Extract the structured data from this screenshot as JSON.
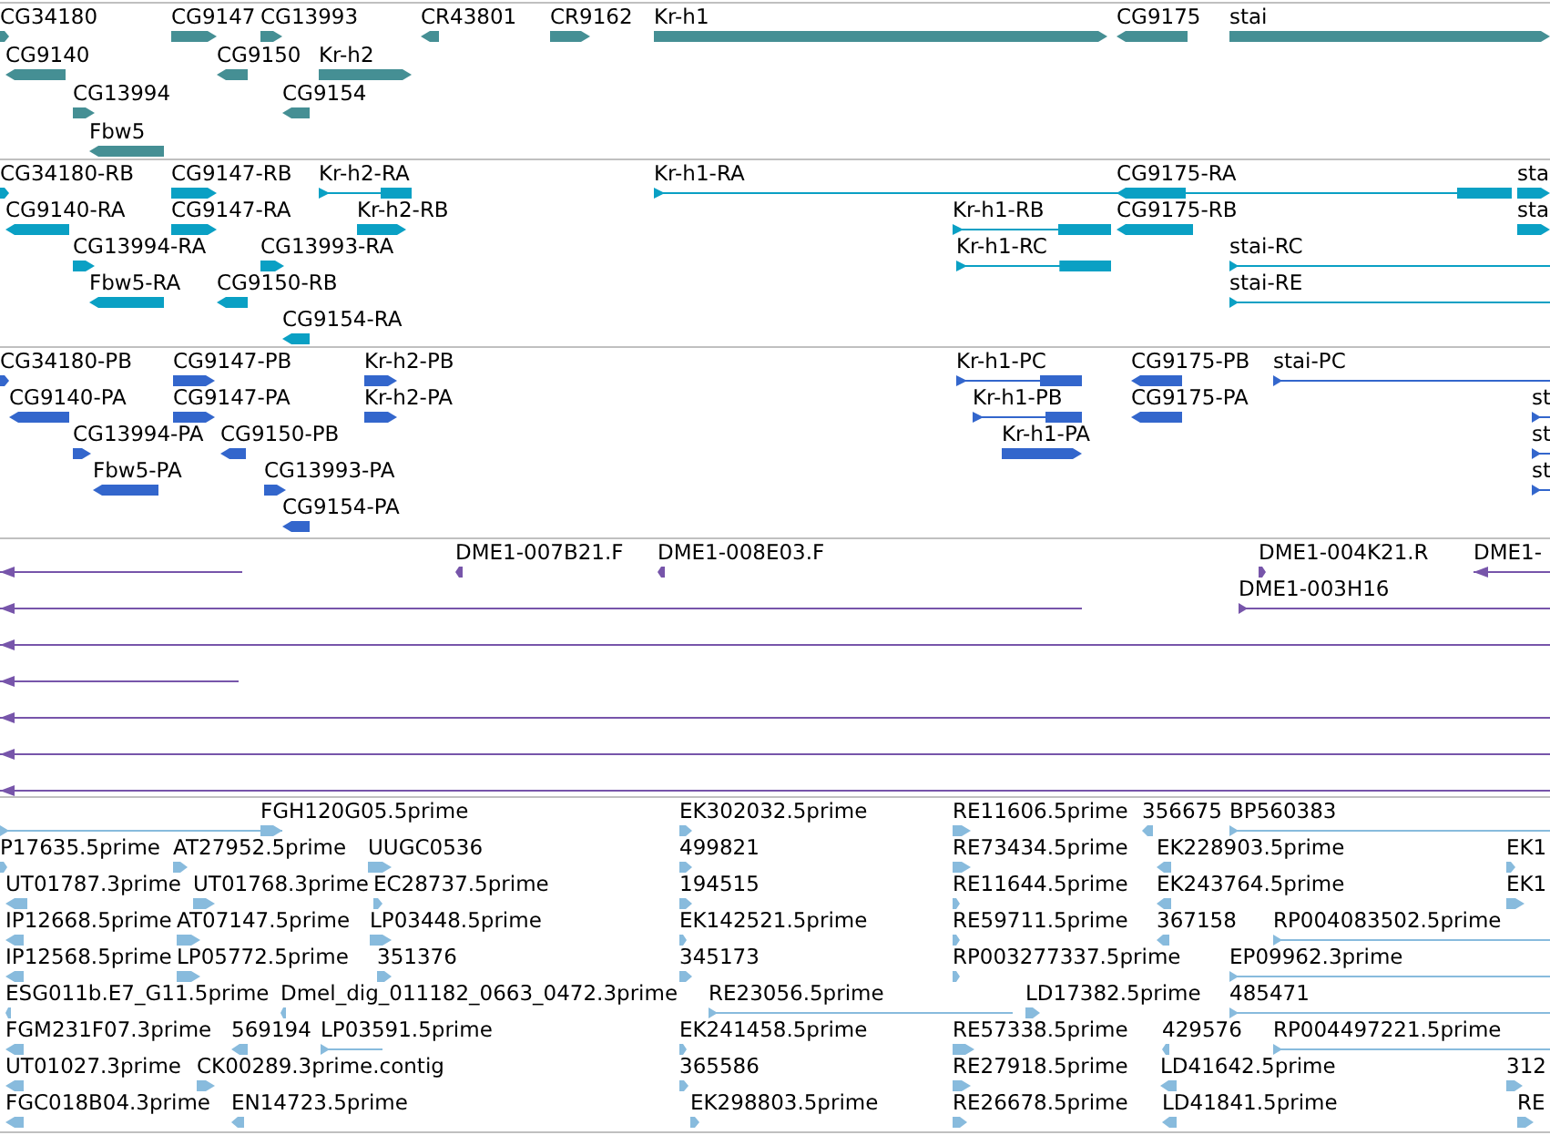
{
  "tracks": [
    {
      "kind": "gene",
      "lanes": [
        {
          "features": [
            {
              "label": "CG34180",
              "reverse": false
            },
            {
              "label": "CG9147",
              "reverse": false
            },
            {
              "label": "CG13993",
              "reverse": false
            },
            {
              "label": "CR43801",
              "reverse": true
            },
            {
              "label": "CR9162",
              "reverse": false
            },
            {
              "label": "Kr-h1",
              "reverse": false
            },
            {
              "label": "CG9175",
              "reverse": true
            },
            {
              "label": "stai",
              "reverse": false
            }
          ]
        },
        {
          "features": [
            {
              "label": "CG9140",
              "reverse": true
            },
            {
              "label": "CG9150",
              "reverse": true
            },
            {
              "label": "Kr-h2",
              "reverse": false
            }
          ]
        },
        {
          "features": [
            {
              "label": "CG13994",
              "reverse": false
            },
            {
              "label": "CG9154",
              "reverse": true
            }
          ]
        },
        {
          "features": [
            {
              "label": "Fbw5",
              "reverse": true
            }
          ]
        }
      ]
    },
    {
      "kind": "mrna",
      "lanes": [
        {
          "features": [
            {
              "label": "CG34180-RB",
              "reverse": false
            },
            {
              "label": "CG9147-RB",
              "reverse": false
            },
            {
              "label": "Kr-h2-RA",
              "reverse": false
            },
            {
              "label": "Kr-h1-RA",
              "reverse": false
            },
            {
              "label": "CG9175-RA",
              "reverse": true
            },
            {
              "label": "sta",
              "reverse": false
            }
          ]
        },
        {
          "features": [
            {
              "label": "CG9140-RA",
              "reverse": true
            },
            {
              "label": "CG9147-RA",
              "reverse": false
            },
            {
              "label": "Kr-h2-RB",
              "reverse": false
            },
            {
              "label": "Kr-h1-RB",
              "reverse": false
            },
            {
              "label": "CG9175-RB",
              "reverse": true
            },
            {
              "label": "sta",
              "reverse": false
            }
          ]
        },
        {
          "features": [
            {
              "label": "CG13994-RA",
              "reverse": false
            },
            {
              "label": "CG13993-RA",
              "reverse": false
            },
            {
              "label": "Kr-h1-RC",
              "reverse": false
            },
            {
              "label": "stai-RC",
              "reverse": false
            }
          ]
        },
        {
          "features": [
            {
              "label": "Fbw5-RA",
              "reverse": true
            },
            {
              "label": "CG9150-RB",
              "reverse": true
            },
            {
              "label": "stai-RE",
              "reverse": false
            }
          ]
        },
        {
          "features": [
            {
              "label": "CG9154-RA",
              "reverse": true
            }
          ]
        }
      ]
    },
    {
      "kind": "protein",
      "lanes": [
        {
          "features": [
            {
              "label": "CG34180-PB",
              "reverse": false
            },
            {
              "label": "CG9147-PB",
              "reverse": false
            },
            {
              "label": "Kr-h2-PB",
              "reverse": false
            },
            {
              "label": "Kr-h1-PC",
              "reverse": false
            },
            {
              "label": "CG9175-PB",
              "reverse": true
            },
            {
              "label": "stai-PC",
              "reverse": false
            }
          ]
        },
        {
          "features": [
            {
              "label": "CG9140-PA",
              "reverse": true
            },
            {
              "label": "CG9147-PA",
              "reverse": false
            },
            {
              "label": "Kr-h2-PA",
              "reverse": false
            },
            {
              "label": "Kr-h1-PB",
              "reverse": false
            },
            {
              "label": "CG9175-PA",
              "reverse": true
            },
            {
              "label": "st",
              "reverse": false
            }
          ]
        },
        {
          "features": [
            {
              "label": "CG13994-PA",
              "reverse": false
            },
            {
              "label": "CG9150-PB",
              "reverse": true
            },
            {
              "label": "Kr-h1-PA",
              "reverse": false
            },
            {
              "label": "st",
              "reverse": false
            }
          ]
        },
        {
          "features": [
            {
              "label": "Fbw5-PA",
              "reverse": true
            },
            {
              "label": "CG13993-PA",
              "reverse": false
            },
            {
              "label": "st",
              "reverse": false
            }
          ]
        },
        {
          "features": [
            {
              "label": "CG9154-PA",
              "reverse": true
            }
          ]
        }
      ]
    },
    {
      "kind": "clone",
      "lanes": [
        {
          "features": [
            {
              "reverse": true
            },
            {
              "label": "DME1-007B21.F",
              "reverse": true
            },
            {
              "label": "DME1-008E03.F",
              "reverse": true
            },
            {
              "label": "DME1-004K21.R",
              "reverse": false
            },
            {
              "label": "DME1-",
              "reverse": true
            }
          ]
        },
        {
          "features": [
            {
              "reverse": true
            },
            {
              "label": "DME1-003H16",
              "reverse": false
            }
          ]
        },
        {
          "features": [
            {
              "reverse": true
            }
          ]
        },
        {
          "features": [
            {
              "reverse": true
            }
          ]
        },
        {
          "features": [
            {
              "reverse": true
            }
          ]
        },
        {
          "features": [
            {
              "reverse": true
            }
          ]
        },
        {
          "features": [
            {
              "reverse": true
            }
          ]
        }
      ]
    },
    {
      "kind": "est",
      "lanes": [
        {
          "features": [
            {
              "reverse": false
            },
            {
              "label": "FGH120G05.5prime",
              "reverse": false
            },
            {
              "label": "EK302032.5prime",
              "reverse": false
            },
            {
              "label": "RE11606.5prime",
              "reverse": false
            },
            {
              "label": "356675",
              "reverse": true
            },
            {
              "label": "BP560383",
              "reverse": false
            }
          ]
        },
        {
          "features": [
            {
              "label": "P17635.5prime",
              "reverse": false
            },
            {
              "label": "AT27952.5prime",
              "reverse": false
            },
            {
              "label": "UUGC0536",
              "reverse": false
            },
            {
              "label": "499821",
              "reverse": false
            },
            {
              "label": "RE73434.5prime",
              "reverse": false
            },
            {
              "label": "EK228903.5prime",
              "reverse": true
            },
            {
              "label": "EK1",
              "reverse": false
            }
          ]
        },
        {
          "features": [
            {
              "label": "UT01787.3prime",
              "reverse": true
            },
            {
              "label": "UT01768.3prime",
              "reverse": false
            },
            {
              "label": "EC28737.5prime",
              "reverse": false
            },
            {
              "label": "194515",
              "reverse": false
            },
            {
              "label": "RE11644.5prime",
              "reverse": false
            },
            {
              "label": "EK243764.5prime",
              "reverse": true
            },
            {
              "label": "EK1",
              "reverse": false
            }
          ]
        },
        {
          "features": [
            {
              "label": "IP12668.5prime",
              "reverse": true
            },
            {
              "label": "AT07147.5prime",
              "reverse": false
            },
            {
              "label": "LP03448.5prime",
              "reverse": false
            },
            {
              "label": "EK142521.5prime",
              "reverse": false
            },
            {
              "label": "RE59711.5prime",
              "reverse": false
            },
            {
              "label": "367158",
              "reverse": true
            },
            {
              "label": "RP004083502.5prime",
              "reverse": false
            }
          ]
        },
        {
          "features": [
            {
              "label": "IP12568.5prime",
              "reverse": true
            },
            {
              "label": "LP05772.5prime",
              "reverse": false
            },
            {
              "label": "351376",
              "reverse": false
            },
            {
              "label": "345173",
              "reverse": false
            },
            {
              "label": "RP003277337.5prime",
              "reverse": false
            },
            {
              "label": "EP09962.3prime",
              "reverse": false
            }
          ]
        },
        {
          "features": [
            {
              "label": "ESG011b.E7_G11.5prime",
              "reverse": true
            },
            {
              "label": "Dmel_dig_011182_0663_0472.3prime",
              "reverse": true
            },
            {
              "label": "RE23056.5prime",
              "reverse": false
            },
            {
              "label": "LD17382.5prime",
              "reverse": false
            },
            {
              "label": "485471",
              "reverse": false
            }
          ]
        },
        {
          "features": [
            {
              "label": "FGM231F07.3prime",
              "reverse": true
            },
            {
              "label": "569194",
              "reverse": true
            },
            {
              "label": "LP03591.5prime",
              "reverse": false
            },
            {
              "label": "EK241458.5prime",
              "reverse": false
            },
            {
              "label": "RE57338.5prime",
              "reverse": false
            },
            {
              "label": "429576",
              "reverse": true
            },
            {
              "label": "RP004497221.5prime",
              "reverse": false
            }
          ]
        },
        {
          "features": [
            {
              "label": "UT01027.3prime",
              "reverse": true
            },
            {
              "label": "CK00289.3prime.contig",
              "reverse": false
            },
            {
              "label": "365586",
              "reverse": false
            },
            {
              "label": "RE27918.5prime",
              "reverse": false
            },
            {
              "label": "LD41642.5prime",
              "reverse": true
            },
            {
              "label": "312",
              "reverse": false
            }
          ]
        },
        {
          "features": [
            {
              "label": "FGC018B04.3prime",
              "reverse": true
            },
            {
              "label": "EN14723.5prime",
              "reverse": true
            },
            {
              "label": "EK298803.5prime",
              "reverse": false
            },
            {
              "label": "RE26678.5prime",
              "reverse": false
            },
            {
              "label": "LD41841.5prime",
              "reverse": true
            },
            {
              "label": "RE",
              "reverse": false
            }
          ]
        }
      ]
    }
  ]
}
